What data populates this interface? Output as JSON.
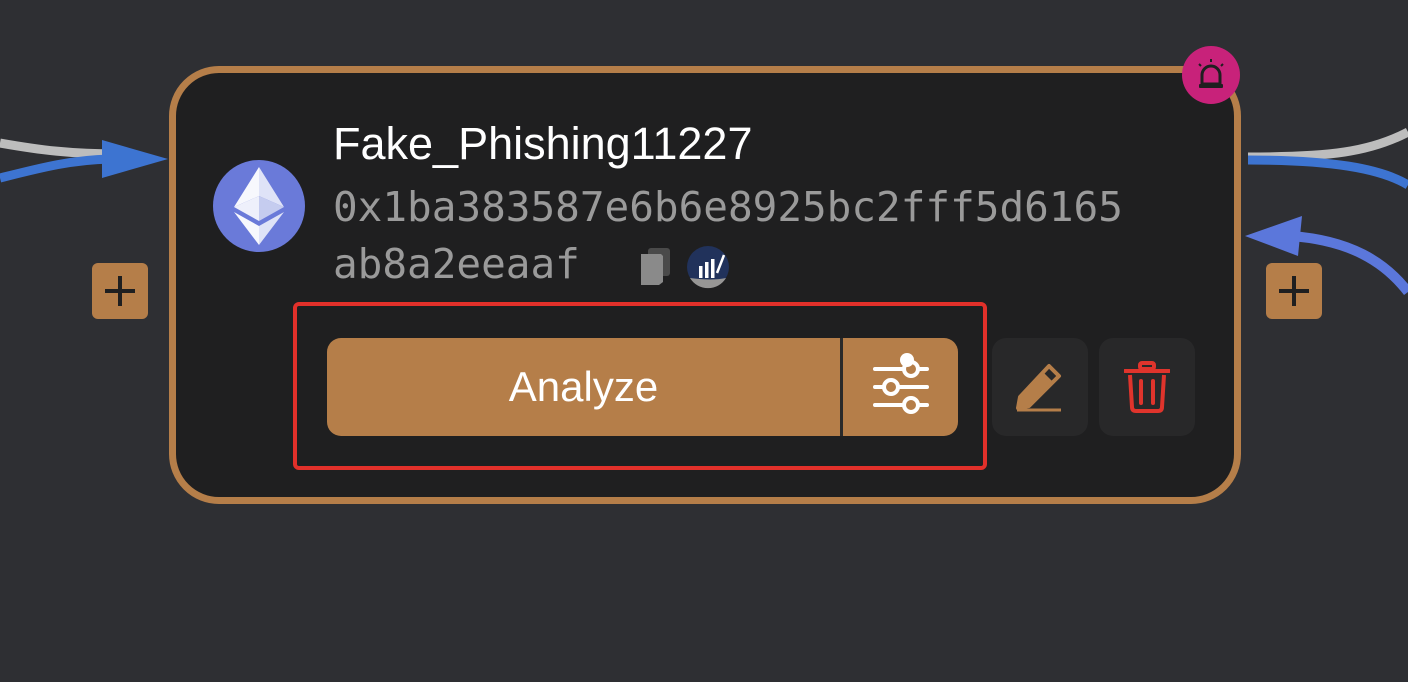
{
  "node": {
    "title": "Fake_Phishing11227",
    "address_line1": "0x1ba383587e6b6e8925bc2fff5d6165",
    "address_line2": "ab8a2eeaaf",
    "chain_icon": "ethereum-icon",
    "alert_icon": "siren-icon",
    "copy_icon": "copy-icon",
    "explorer_icon": "block-explorer-icon"
  },
  "actions": {
    "analyze_label": "Analyze",
    "settings_icon": "sliders-icon",
    "settings_has_indicator": true,
    "edit_icon": "pencil-icon",
    "delete_icon": "trash-icon"
  },
  "handles": {
    "add_left_icon": "plus-icon",
    "add_right_icon": "plus-icon"
  },
  "colors": {
    "background": "#2e2f33",
    "node_fill": "#1f1f20",
    "accent": "#b57e49",
    "alert": "#c8227a",
    "ethereum": "#6a7ad9",
    "delete": "#e0342c",
    "highlight": "#e1302a",
    "edge_blue": "#3d74d1",
    "edge_gray": "#bdbdbd",
    "edge_incoming": "#5b77db"
  }
}
